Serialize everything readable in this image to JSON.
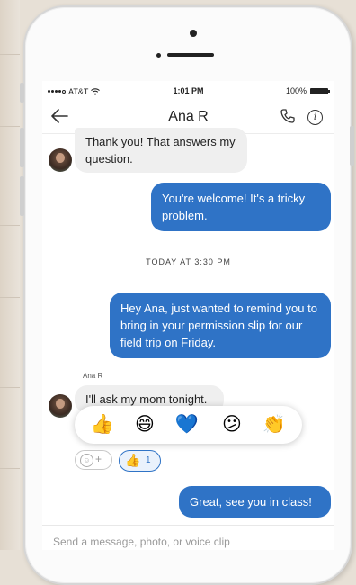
{
  "status_bar": {
    "carrier": "AT&T",
    "time": "1:01 PM",
    "battery": "100%"
  },
  "header": {
    "title": "Ana R"
  },
  "messages": [
    {
      "direction": "in",
      "text": "Thank you! That answers my question."
    },
    {
      "direction": "out",
      "text": "You're welcome! It's a tricky problem."
    },
    {
      "direction": "out",
      "text": "Hey Ana, just wanted to remind you to bring in your permission slip for our field trip on Friday."
    },
    {
      "direction": "in",
      "text": "I'll ask my mom tonight."
    },
    {
      "direction": "out",
      "text": "Great, see you in class!"
    }
  ],
  "timestamp": "TODAY AT 3:30 PM",
  "sender_name": "Ana R",
  "reactions": {
    "options": [
      "thumbs-up",
      "grinning-face",
      "blue-heart",
      "confused-face",
      "clapping-hands"
    ],
    "glyphs": [
      "👍",
      "😄",
      "💙",
      "😕",
      "👏"
    ],
    "selected": {
      "glyph": "👍",
      "count": "1"
    },
    "add_plus": "+"
  },
  "composer": {
    "placeholder": "Send a message, photo, or voice clip"
  },
  "colors": {
    "outgoing": "#2f73c6",
    "incoming": "#efefef",
    "emoji": "#f6c744"
  },
  "icons": {
    "back": "back-arrow-icon",
    "call": "phone-icon",
    "info": "info-icon"
  }
}
